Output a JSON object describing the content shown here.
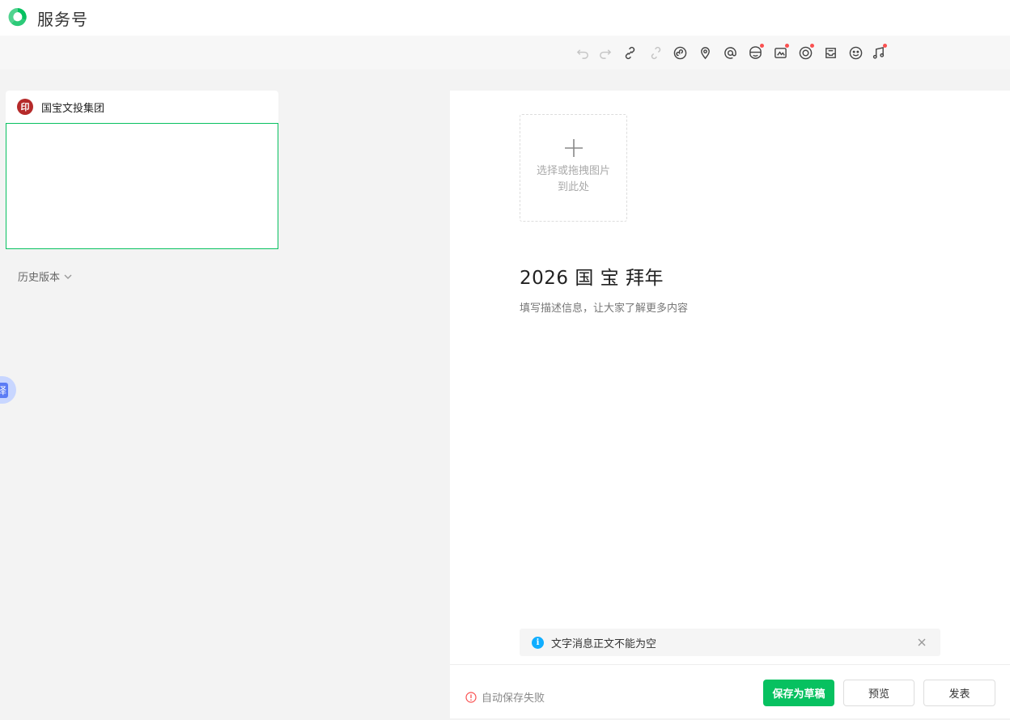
{
  "app": {
    "brand": "服务号",
    "brand_color": "#07c160"
  },
  "toolbar": {
    "items": [
      {
        "name": "undo-icon",
        "disabled": true
      },
      {
        "name": "redo-icon",
        "disabled": true
      },
      {
        "name": "link-icon",
        "disabled": false
      },
      {
        "name": "unlink-icon",
        "disabled": true
      },
      {
        "name": "mini-program-icon",
        "disabled": false
      },
      {
        "name": "location-icon",
        "disabled": false
      },
      {
        "name": "mention-icon",
        "disabled": false
      },
      {
        "name": "sticker-icon",
        "disabled": false,
        "dot": true
      },
      {
        "name": "image-icon",
        "disabled": false,
        "dot": true
      },
      {
        "name": "circle-icon",
        "disabled": false,
        "dot": true
      },
      {
        "name": "inbox-icon",
        "disabled": false
      },
      {
        "name": "emoji-icon",
        "disabled": false
      },
      {
        "name": "music-icon",
        "disabled": false,
        "dot": true
      }
    ]
  },
  "left": {
    "account_name": "国宝文投集团",
    "history_label": "历史版本",
    "float_tab_label": "译"
  },
  "editor": {
    "upload_text": "选择或拖拽图片到此处",
    "title": "2026 国 宝 拜年",
    "description_placeholder": "填写描述信息，让大家了解更多内容",
    "notice_text": "文字消息正文不能为空",
    "notice_icon": "i"
  },
  "footer": {
    "autosave_status": "自动保存失败",
    "save_draft_label": "保存为草稿",
    "preview_label": "预览",
    "publish_label": "发表"
  }
}
